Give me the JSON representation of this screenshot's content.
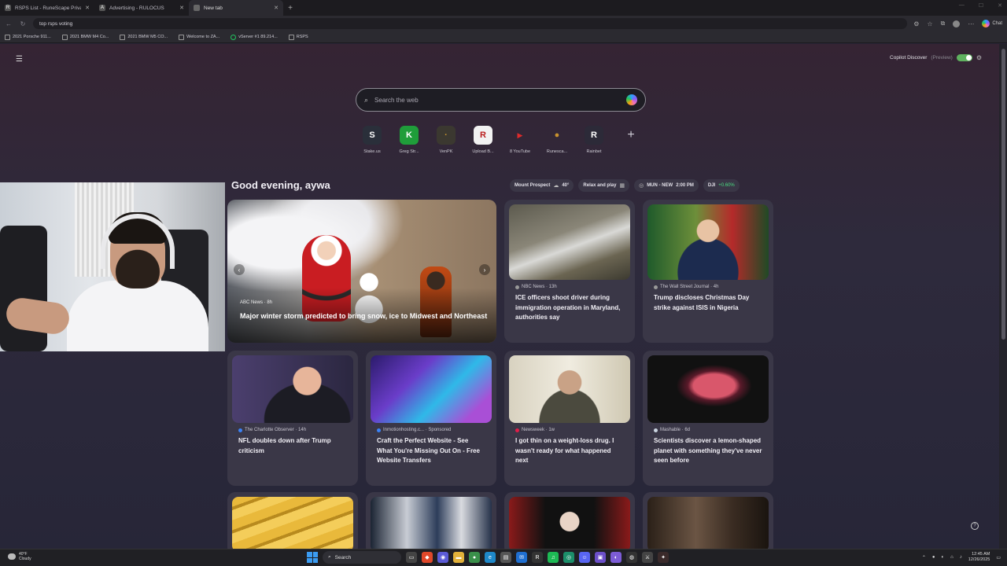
{
  "tabs": [
    {
      "title": "RSPS List - RuneScape Private Ser...",
      "icon": "R",
      "color": "#444"
    },
    {
      "title": "Advertising - RULOCUS",
      "icon": "A",
      "color": "#3a3a3a"
    },
    {
      "title": "New tab",
      "icon": "",
      "color": "#555"
    }
  ],
  "address": {
    "value": "top rsps voting"
  },
  "bookmarks": [
    "2021 Porsche 911...",
    "2021 BMW M4 Co...",
    "2021 BMW M5 CO...",
    "Welcome to ZA...",
    "vServer #1 89.214...",
    "RSPS"
  ],
  "copilot_chat": "Chat",
  "ntp": {
    "copilot_discover": "Copilot Discover",
    "preview": "(Preview)",
    "search_placeholder": "Search the web",
    "quick_links": [
      {
        "label": "Stake.us",
        "glyph": "S",
        "color": "#2a2f3a"
      },
      {
        "label": "Greg Str...",
        "glyph": "K",
        "color": "#1f9d3a"
      },
      {
        "label": "VenPK",
        "glyph": "·",
        "color": "#3b3830"
      },
      {
        "label": "Upload B...",
        "glyph": "R",
        "color": "#f2f2f2"
      },
      {
        "label": "8 YouTube",
        "glyph": "▶",
        "color": "#e02b2b"
      },
      {
        "label": "Runesca...",
        "glyph": "●",
        "color": "#c8922e"
      },
      {
        "label": "Rainbet",
        "glyph": "R",
        "color": "#2c2a38"
      }
    ],
    "greeting": "Good evening, aywa",
    "pills": {
      "weather_city": "Mount Prospect",
      "weather_temp": "40°",
      "relax": "Relax and play",
      "game": "MUN - NEW",
      "game_time": "2:00 PM",
      "stock": "DJI",
      "stock_change": "+0.60%"
    },
    "hero": {
      "source": "ABC News · 8h",
      "headline": "Major winter storm predicted to bring snow, ice to Midwest and Northeast"
    },
    "cards": [
      {
        "source": "NBC News · 13h",
        "title": "ICE officers shoot driver during immigration operation in Maryland, authorities say",
        "dot": "#999"
      },
      {
        "source": "The Wall Street Journal · 4h",
        "title": "Trump discloses Christmas Day strike against ISIS in Nigeria",
        "dot": "#999"
      },
      {
        "source": "The Charlotte Observer · 14h",
        "title": "NFL doubles down after Trump criticism",
        "dot": "#3b82f6"
      },
      {
        "source": "Inmotionhosting.c... · Sponsored",
        "title": "Craft the Perfect Website - See What You're Missing Out On - Free Website Transfers",
        "dot": "#3b82f6"
      },
      {
        "source": "Newsweek · 1w",
        "title": "I got thin on a weight-loss drug. I wasn't ready for what happened next",
        "dot": "#e11d48"
      },
      {
        "source": "Mashable · 6d",
        "title": "Scientists discover a lemon-shaped planet with something they've never seen before",
        "dot": "#cbd5e1"
      }
    ]
  },
  "taskbar": {
    "weather_temp": "40°F",
    "weather_desc": "Cloudy",
    "search": "Search",
    "time": "12:45 AM",
    "date": "12/26/2025"
  }
}
